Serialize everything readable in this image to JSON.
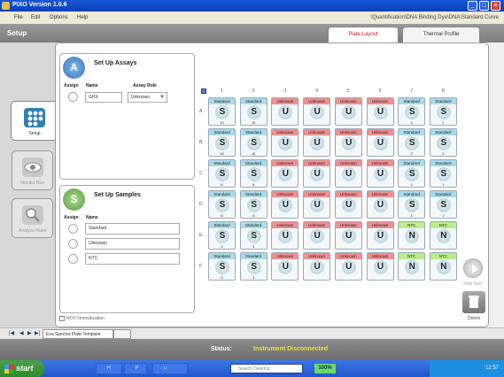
{
  "window": {
    "title": "PIXO  Version 1.0.6",
    "menu": [
      "File",
      "Edit",
      "Options",
      "Help"
    ],
    "breadcrumb": "\\Quantification\\DNA Binding Dye\\DNA\\Standard Curve"
  },
  "header": {
    "section": "Setup",
    "tabs": [
      "Plate Layout",
      "Thermal Profile"
    ],
    "active_tab": "Plate Layout"
  },
  "sidebar": {
    "items": [
      {
        "label": "Setup",
        "icon": "plate-grid-icon",
        "active": true
      },
      {
        "label": "Monitor Run",
        "icon": "eye-icon",
        "active": false
      },
      {
        "label": "Analyze Runs",
        "icon": "magnifier-icon",
        "active": false
      }
    ]
  },
  "assays": {
    "badge": "A",
    "title": "Set Up Assays",
    "col_assign": "Assign",
    "col_name": "Name",
    "col_role": "Assay Role",
    "name_value": "GHX",
    "role_value": "Unknown"
  },
  "samples": {
    "badge": "S",
    "title": "Set Up Samples",
    "col_assign": "Assign",
    "col_name": "Name",
    "items": [
      "Standard",
      "Unknown",
      "NTC"
    ]
  },
  "rox": {
    "label": "ROX Normalization"
  },
  "plate": {
    "columns": [
      "1",
      "2",
      "3",
      "4",
      "5",
      "6",
      "7",
      "8"
    ],
    "rows": [
      "A",
      "B",
      "C",
      "D",
      "E",
      "F"
    ],
    "role_colors": {
      "Standard": "#a9dbe9",
      "Unknown": "#f08f8f",
      "NTC": "#b9ee8a"
    },
    "wells": [
      [
        {
          "role": "Standard",
          "letter": "S",
          "qty": "10"
        },
        {
          "role": "Standard",
          "letter": "S",
          "qty": "10"
        },
        {
          "role": "Unknown",
          "letter": "U",
          "qty": ""
        },
        {
          "role": "Unknown",
          "letter": "U",
          "qty": ""
        },
        {
          "role": "Unknown",
          "letter": "U",
          "qty": ""
        },
        {
          "role": "Unknown",
          "letter": "U",
          "qty": ""
        },
        {
          "role": "Standard",
          "letter": "S",
          "qty": "2"
        },
        {
          "role": "Standard",
          "letter": "S",
          "qty": "2"
        }
      ],
      [
        {
          "role": "Standard",
          "letter": "S",
          "qty": "16"
        },
        {
          "role": "Standard",
          "letter": "S",
          "qty": "16"
        },
        {
          "role": "Unknown",
          "letter": "U",
          "qty": ""
        },
        {
          "role": "Unknown",
          "letter": "U",
          "qty": ""
        },
        {
          "role": "Unknown",
          "letter": "U",
          "qty": ""
        },
        {
          "role": "Unknown",
          "letter": "U",
          "qty": ""
        },
        {
          "role": "Standard",
          "letter": "S",
          "qty": "2"
        },
        {
          "role": "Standard",
          "letter": "S",
          "qty": "2"
        }
      ],
      [
        {
          "role": "Standard",
          "letter": "S",
          "qty": "8"
        },
        {
          "role": "Standard",
          "letter": "S",
          "qty": "8"
        },
        {
          "role": "Unknown",
          "letter": "U",
          "qty": ""
        },
        {
          "role": "Unknown",
          "letter": "U",
          "qty": ""
        },
        {
          "role": "Unknown",
          "letter": "U",
          "qty": ""
        },
        {
          "role": "Unknown",
          "letter": "U",
          "qty": ""
        },
        {
          "role": "Standard",
          "letter": "S",
          "qty": "1"
        },
        {
          "role": "Standard",
          "letter": "S",
          "qty": "1"
        }
      ],
      [
        {
          "role": "Standard",
          "letter": "S",
          "qty": "8"
        },
        {
          "role": "Standard",
          "letter": "S",
          "qty": "8"
        },
        {
          "role": "Unknown",
          "letter": "U",
          "qty": ""
        },
        {
          "role": "Unknown",
          "letter": "U",
          "qty": ""
        },
        {
          "role": "Unknown",
          "letter": "U",
          "qty": ""
        },
        {
          "role": "Unknown",
          "letter": "U",
          "qty": ""
        },
        {
          "role": "Standard",
          "letter": "S",
          "qty": "1"
        },
        {
          "role": "Standard",
          "letter": "S",
          "qty": "1"
        }
      ],
      [
        {
          "role": "Standard",
          "letter": "S",
          "qty": "4"
        },
        {
          "role": "Standard",
          "letter": "S",
          "qty": "4"
        },
        {
          "role": "Unknown",
          "letter": "U",
          "qty": ""
        },
        {
          "role": "Unknown",
          "letter": "U",
          "qty": ""
        },
        {
          "role": "Unknown",
          "letter": "U",
          "qty": ""
        },
        {
          "role": "Unknown",
          "letter": "U",
          "qty": ""
        },
        {
          "role": "NTC",
          "letter": "N",
          "qty": ""
        },
        {
          "role": "NTC",
          "letter": "N",
          "qty": ""
        }
      ],
      [
        {
          "role": "Standard",
          "letter": "S",
          "qty": "4"
        },
        {
          "role": "Standard",
          "letter": "S",
          "qty": "4"
        },
        {
          "role": "Unknown",
          "letter": "U",
          "qty": ""
        },
        {
          "role": "Unknown",
          "letter": "U",
          "qty": ""
        },
        {
          "role": "Unknown",
          "letter": "U",
          "qty": ""
        },
        {
          "role": "Unknown",
          "letter": "U",
          "qty": ""
        },
        {
          "role": "NTC",
          "letter": "N",
          "qty": ""
        },
        {
          "role": "NTC",
          "letter": "N",
          "qty": ""
        }
      ]
    ]
  },
  "actions": {
    "start_run": "Start Run",
    "delete": "Delete"
  },
  "bottom": {
    "template_tab": "Eva Spectra Plate Template"
  },
  "status": {
    "label": "Status:",
    "value": "Instrument Disconnected"
  },
  "taskbar": {
    "start": "start",
    "tasks": [
      "H",
      "P",
      "u"
    ],
    "search_placeholder": "Search Desktop",
    "zoom": "100%",
    "clock": "12:57"
  }
}
